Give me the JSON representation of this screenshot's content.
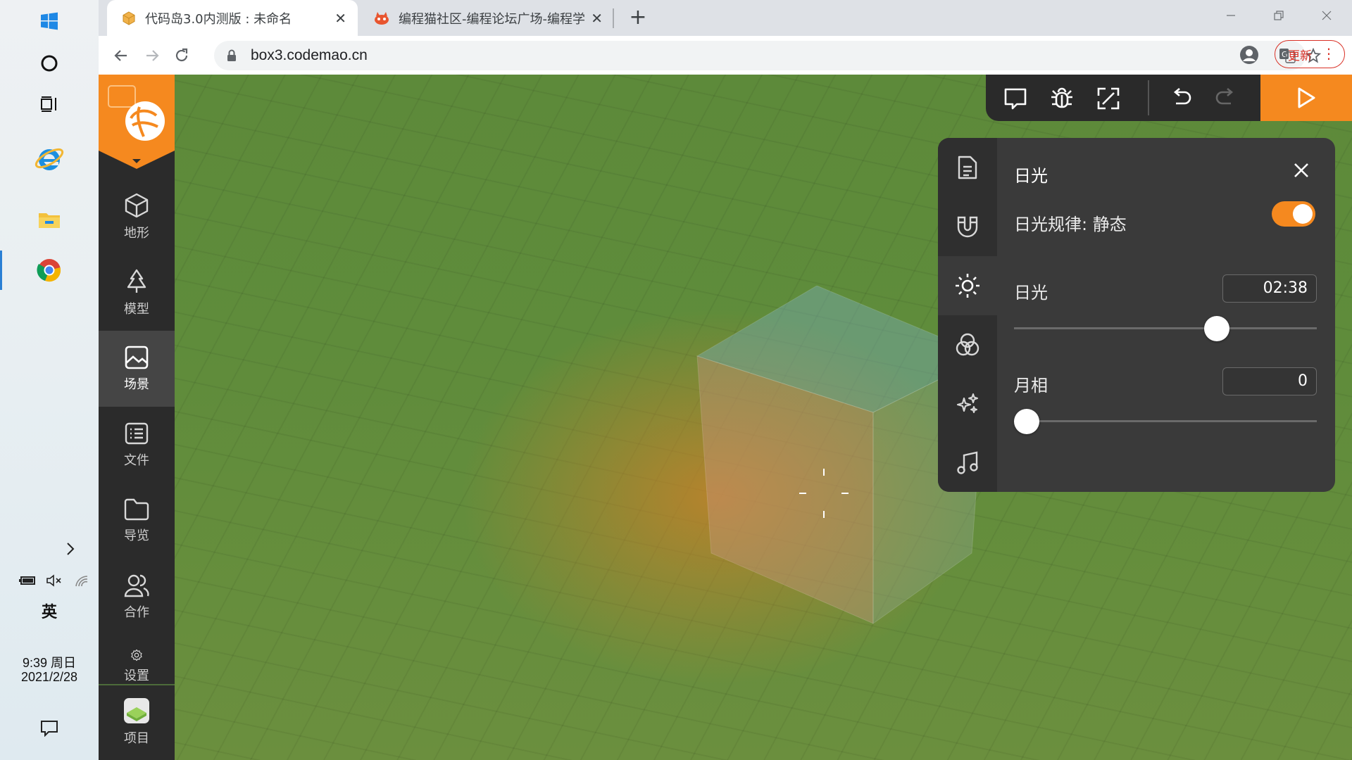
{
  "taskbar": {
    "language": "英",
    "time": "9:39 周日",
    "date": "2021/2/28"
  },
  "browser": {
    "tabs": [
      {
        "title": "代码岛3.0内测版 : 未命名",
        "active": true
      },
      {
        "title": "编程猫社区-编程论坛广场-编程学",
        "active": false
      }
    ],
    "url": "box3.codemao.cn",
    "update_label": "更新"
  },
  "sidebar": {
    "items": [
      {
        "label": "地形",
        "icon": "cube-icon"
      },
      {
        "label": "模型",
        "icon": "tree-icon"
      },
      {
        "label": "场景",
        "icon": "image-icon",
        "active": true
      },
      {
        "label": "文件",
        "icon": "file-list-icon"
      },
      {
        "label": "导览",
        "icon": "folder-icon"
      },
      {
        "label": "合作",
        "icon": "users-icon"
      },
      {
        "label": "设置",
        "icon": "gear-icon"
      },
      {
        "label": "项目",
        "icon": "project-thumbnail"
      }
    ]
  },
  "panel": {
    "title": "日光",
    "rule_label": "日光规律: 静态",
    "rule_toggle_on": true,
    "daylight_label": "日光",
    "daylight_value": "02:38",
    "daylight_fraction": 0.67,
    "moon_label": "月相",
    "moon_value": "0",
    "moon_fraction": 0.0
  },
  "colors": {
    "accent": "#f5891f",
    "sidebar_bg": "#2b2b2b",
    "panel_bg": "#3a3a3a"
  }
}
